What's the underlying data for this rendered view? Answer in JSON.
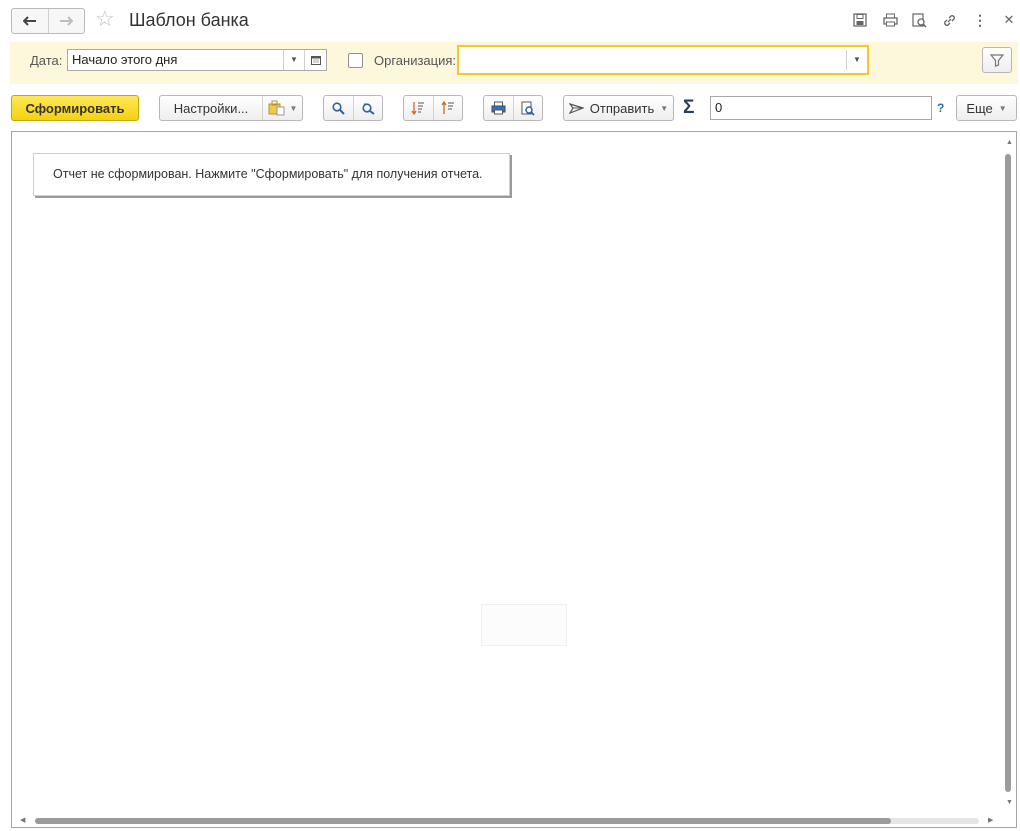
{
  "window": {
    "title": "Шаблон банка"
  },
  "filters": {
    "date_label": "Дата:",
    "date_value": "Начало этого дня",
    "org_label": "Организация:",
    "org_value": ""
  },
  "toolbar": {
    "generate_label": "Сформировать",
    "settings_label": "Настройки...",
    "send_label": "Отправить",
    "sum_symbol": "Σ",
    "sum_value": "0",
    "help_label": "?",
    "more_label": "Еще"
  },
  "report": {
    "message": "Отчет не сформирован. Нажмите \"Сформировать\" для получения отчета."
  },
  "colors": {
    "accent_yellow": "#f5d20d",
    "filter_panel_bg": "#fdf8dc",
    "focus_border": "#f3c82b"
  },
  "icons": [
    "arrow-left-icon",
    "arrow-right-icon",
    "star-icon",
    "save-icon",
    "print-icon",
    "preview-icon",
    "link-icon",
    "more-vertical-icon",
    "close-icon",
    "calendar-icon",
    "filter-icon",
    "variant-icon",
    "search-icon",
    "search-next-icon",
    "sort-desc-icon",
    "sort-asc-icon",
    "send-icon",
    "sigma-icon"
  ]
}
